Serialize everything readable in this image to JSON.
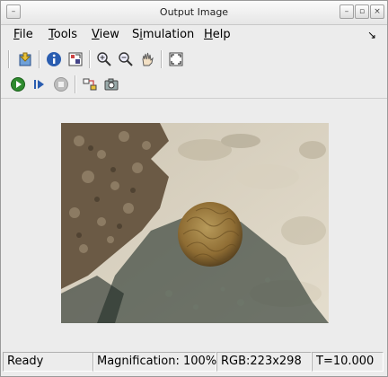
{
  "window": {
    "title": "Output Image"
  },
  "menu": {
    "items": [
      {
        "label": "File",
        "mnemonic": "F",
        "rest": "ile"
      },
      {
        "label": "Tools",
        "mnemonic": "T",
        "rest": "ools"
      },
      {
        "label": "View",
        "mnemonic": "V",
        "rest": "iew"
      },
      {
        "label": "Simulation",
        "pre": "S",
        "mnemonic": "i",
        "rest": "mulation"
      },
      {
        "label": "Help",
        "mnemonic": "H",
        "rest": "elp"
      }
    ]
  },
  "toolbar1": [
    "open-in-editor-icon",
    "info-icon",
    "pixel-region-icon",
    "zoom-in-icon",
    "zoom-out-icon",
    "pan-hand-icon",
    "fit-to-window-icon"
  ],
  "toolbar2": [
    "run-icon",
    "step-icon",
    "stop-icon",
    "highlight-block-icon",
    "snapshot-camera-icon"
  ],
  "status": {
    "ready": "Ready",
    "magnification": "Magnification: 100%",
    "dims": "RGB:223x298",
    "time": "T=10.000"
  },
  "colors": {
    "accent_green": "#2e8b2e",
    "accent_blue": "#2a5db0"
  }
}
